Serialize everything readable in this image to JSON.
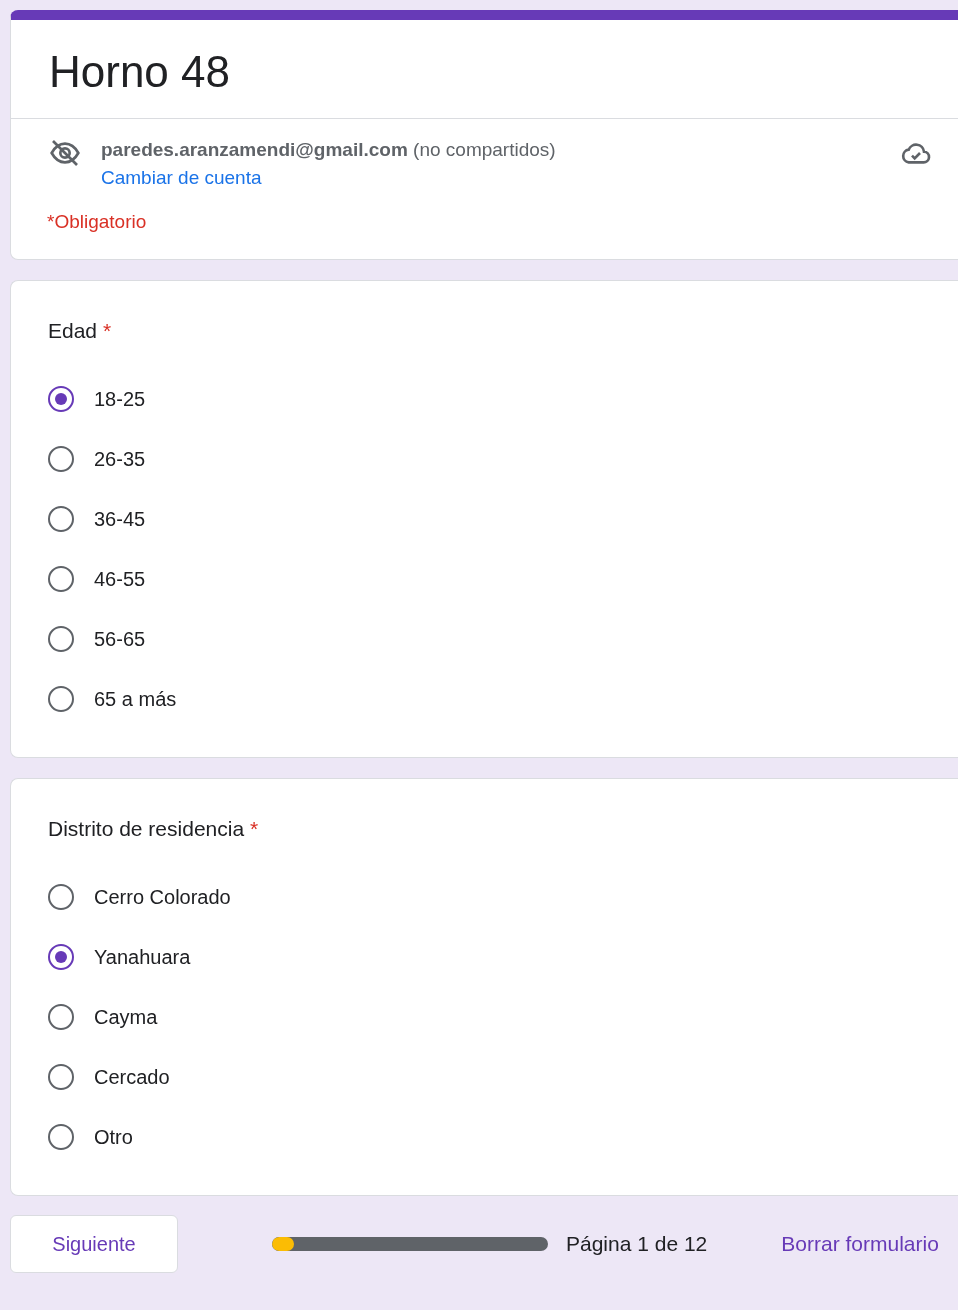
{
  "form": {
    "title": "Horno 48",
    "account": {
      "email": "paredes.aranzamendi@gmail.com",
      "note": "(no compartidos)",
      "switch_link": "Cambiar de cuenta"
    },
    "required_note": "*Obligatorio"
  },
  "questions": [
    {
      "title": "Edad",
      "required_mark": "*",
      "options": [
        {
          "label": "18-25",
          "selected": true
        },
        {
          "label": "26-35",
          "selected": false
        },
        {
          "label": "36-45",
          "selected": false
        },
        {
          "label": "46-55",
          "selected": false
        },
        {
          "label": "56-65",
          "selected": false
        },
        {
          "label": "65 a más",
          "selected": false
        }
      ]
    },
    {
      "title": "Distrito de residencia",
      "required_mark": "*",
      "options": [
        {
          "label": "Cerro Colorado",
          "selected": false
        },
        {
          "label": "Yanahuara",
          "selected": true
        },
        {
          "label": "Cayma",
          "selected": false
        },
        {
          "label": "Cercado",
          "selected": false
        },
        {
          "label": "Otro",
          "selected": false
        }
      ]
    }
  ],
  "footer": {
    "next_button": "Siguiente",
    "progress": {
      "level": 0.08
    },
    "page_label": "Página 1 de 12",
    "clear_link": "Borrar formulario"
  }
}
